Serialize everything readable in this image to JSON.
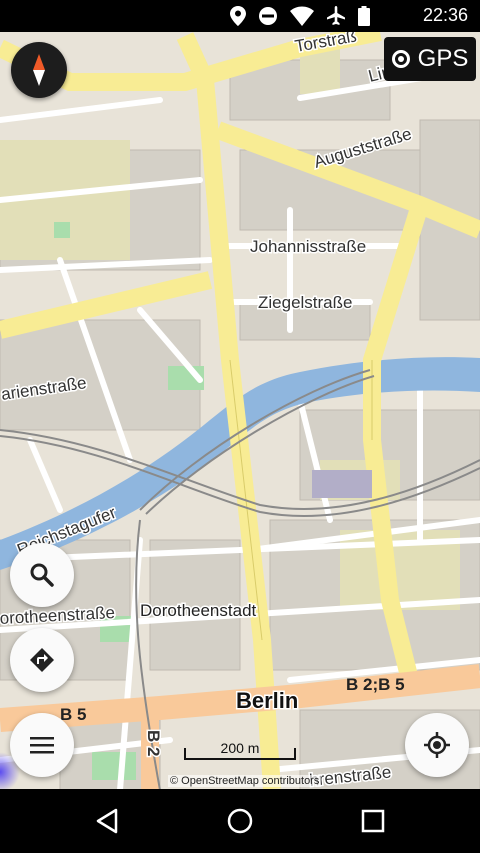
{
  "status_bar": {
    "time": "22:36",
    "icons": [
      "location-icon",
      "do-not-disturb-icon",
      "wifi-icon",
      "airplane-icon",
      "battery-icon"
    ]
  },
  "gps_button": {
    "label": "GPS"
  },
  "map": {
    "street_labels": {
      "torstrasse": "Torstraß",
      "linien": "Lin",
      "auguststrasse": "Auguststraße",
      "johannisstrasse": "Johannisstraße",
      "ziegelstrasse": "Ziegelstraße",
      "marienstrasse": "arienstraße",
      "reichstagufer": "Reichstagufer",
      "dorotheenstrasse": "orotheenstraße",
      "behrenstrasse": "hrenstraße",
      "b2_vertical": "B 2"
    },
    "place_labels": {
      "dorotheenstadt": "Dorotheenstadt",
      "berlin": "Berlin"
    },
    "shields": {
      "b5_left": "B 5",
      "b2_b5": "B 2;B 5"
    },
    "scale_label": "200 m",
    "attribution": "© OpenStreetMap contributors"
  },
  "colors": {
    "land": "#e8e3d8",
    "river": "#8fb6de",
    "primary_road": "#f8ec94",
    "trunk_road": "#f9c99a",
    "building": "#d4d0c7",
    "park": "#a9ddac"
  },
  "controls": {
    "compass": "compass-icon",
    "search": "search-icon",
    "directions": "directions-icon",
    "menu": "menu-icon",
    "my_location": "my-location-icon"
  },
  "nav_bar": [
    "back-icon",
    "home-icon",
    "recents-icon"
  ]
}
